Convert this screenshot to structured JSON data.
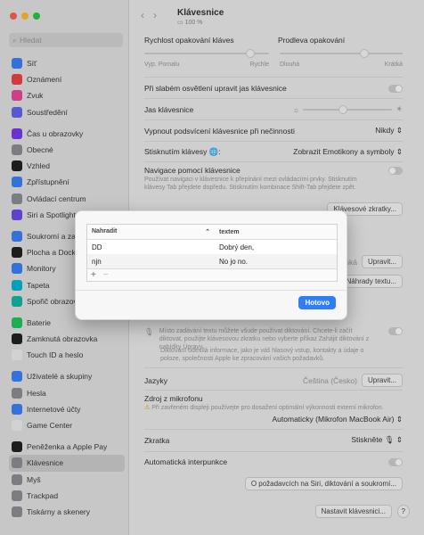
{
  "colors": {
    "close": "#fe5f57",
    "minimize": "#febc2e",
    "maximize": "#28c840",
    "accent": "#2f7ef5"
  },
  "sidebar": {
    "search_placeholder": "Hledat",
    "items": [
      {
        "label": "Síť",
        "icon": "network-icon",
        "color": "#3b82f6"
      },
      {
        "label": "Oznámení",
        "icon": "bell-icon",
        "color": "#ef4444"
      },
      {
        "label": "Zvuk",
        "icon": "speaker-icon",
        "color": "#ec4899"
      },
      {
        "label": "Soustředění",
        "icon": "moon-icon",
        "color": "#6366f1"
      },
      {
        "label": "Čas u obrazovky",
        "icon": "hourglass-icon",
        "color": "#7c3aed"
      },
      {
        "label": "Obecné",
        "icon": "gear-icon",
        "color": "#8e8e93"
      },
      {
        "label": "Vzhled",
        "icon": "appearance-icon",
        "color": "#222222"
      },
      {
        "label": "Zpřístupnění",
        "icon": "accessibility-icon",
        "color": "#3b82f6"
      },
      {
        "label": "Ovládací centrum",
        "icon": "control-center-icon",
        "color": "#8e8e93"
      },
      {
        "label": "Siri a Spotlight",
        "icon": "siri-icon",
        "color": "#6b4ce6"
      },
      {
        "label": "Soukromí a zabezpečení",
        "icon": "hand-icon",
        "color": "#3b82f6"
      },
      {
        "label": "Plocha a Dock",
        "icon": "dock-icon",
        "color": "#222222"
      },
      {
        "label": "Monitory",
        "icon": "display-icon",
        "color": "#3b82f6"
      },
      {
        "label": "Tapeta",
        "icon": "wallpaper-icon",
        "color": "#06b6d4"
      },
      {
        "label": "Spořič obrazovky",
        "icon": "screensaver-icon",
        "color": "#14b8a6"
      },
      {
        "label": "Baterie",
        "icon": "battery-icon",
        "color": "#22c55e"
      },
      {
        "label": "Zamknutá obrazovka",
        "icon": "lock-icon",
        "color": "#222222"
      },
      {
        "label": "Touch ID a heslo",
        "icon": "fingerprint-icon",
        "color": "#f0f0f0"
      },
      {
        "label": "Uživatelé a skupiny",
        "icon": "users-icon",
        "color": "#3b82f6"
      },
      {
        "label": "Hesla",
        "icon": "key-icon",
        "color": "#8e8e93"
      },
      {
        "label": "Internetové účty",
        "icon": "at-icon",
        "color": "#3b82f6"
      },
      {
        "label": "Game Center",
        "icon": "game-center-icon",
        "color": "#f0f0f0"
      },
      {
        "label": "Peněženka a Apple Pay",
        "icon": "wallet-icon",
        "color": "#222222"
      },
      {
        "label": "Klávesnice",
        "icon": "keyboard-icon",
        "color": "#8e8e93"
      },
      {
        "label": "Myš",
        "icon": "mouse-icon",
        "color": "#8e8e93"
      },
      {
        "label": "Trackpad",
        "icon": "trackpad-icon",
        "color": "#8e8e93"
      },
      {
        "label": "Tiskárny a skenery",
        "icon": "printer-icon",
        "color": "#8e8e93"
      }
    ]
  },
  "header": {
    "title": "Klávesnice",
    "battery": "100 %"
  },
  "main": {
    "repeat_rate": "Rychlost opakování kláves",
    "repeat_delay": "Prodleva opakování",
    "slow": "Vyp.",
    "slow2": "Pomalu",
    "fast": "Rychle",
    "long": "Dlouhá",
    "short": "Krátká",
    "backlight_low_light": "Při slabém osvětlení upravit jas klávesnice",
    "brightness": "Jas klávesnice",
    "backlight_off": "Vypnout podsvícení klávesnice při nečinnosti",
    "backlight_off_value": "Nikdy",
    "globe_key": "Stisknutím klávesy 🌐:",
    "globe_value": "Zobrazit Emotikony a symboly",
    "nav_title": "Navigace pomocí klávesnice",
    "nav_desc": "Používat navigaci v klávesnice k přepínání mezi ovládacími prvky. Stisknutím klávesy Tab přejdete dopředu. Stisknutím kombinace Shift-Tab přejdete zpět.",
    "shortcuts_button": "Klávesové zkratky...",
    "input_sources_value": "Česká",
    "edit_button": "Upravit...",
    "text_replace_button": "Náhrady textu...",
    "dictation_desc": "Místo zadávání textu můžete všude používat diktování. Chcete-li začít diktovat, použijte klávesovou zkratku nebo vyberte příkaz Zahájit diktování z nabídky Úpravy.",
    "dictation_desc2": "Diktování odesílá informace, jako je váš hlasový vstup, kontakty a údaje o poloze, společnosti Apple ke zpracování vašich požadavků.",
    "languages": "Jazyky",
    "languages_value": "Čeština (Česko)",
    "languages_edit": "Upravit...",
    "mic_source": "Zdroj z mikrofonu",
    "mic_warning": "Při zavřeném displeji používejte pro dosažení optimální výkonnosti externí mikrofon.",
    "mic_value": "Automaticky (Mikrofon MacBook Air)",
    "shortcut": "Zkratka",
    "shortcut_value": "Stiskněte",
    "auto_punct": "Automatická interpunkce",
    "about_siri_button": "O požadavcích na Siri, diktování a soukromí...",
    "setup_keyboard_button": "Nastavit klávesnici...",
    "help_button": "?"
  },
  "dialog": {
    "col_replace": "Nahradit",
    "col_with": "textem",
    "rows": [
      {
        "replace": "DD",
        "with": "Dobrý den,"
      },
      {
        "replace": "njn",
        "with": "No jo no."
      }
    ],
    "add": "+",
    "remove": "−",
    "done_button": "Hotovo"
  }
}
